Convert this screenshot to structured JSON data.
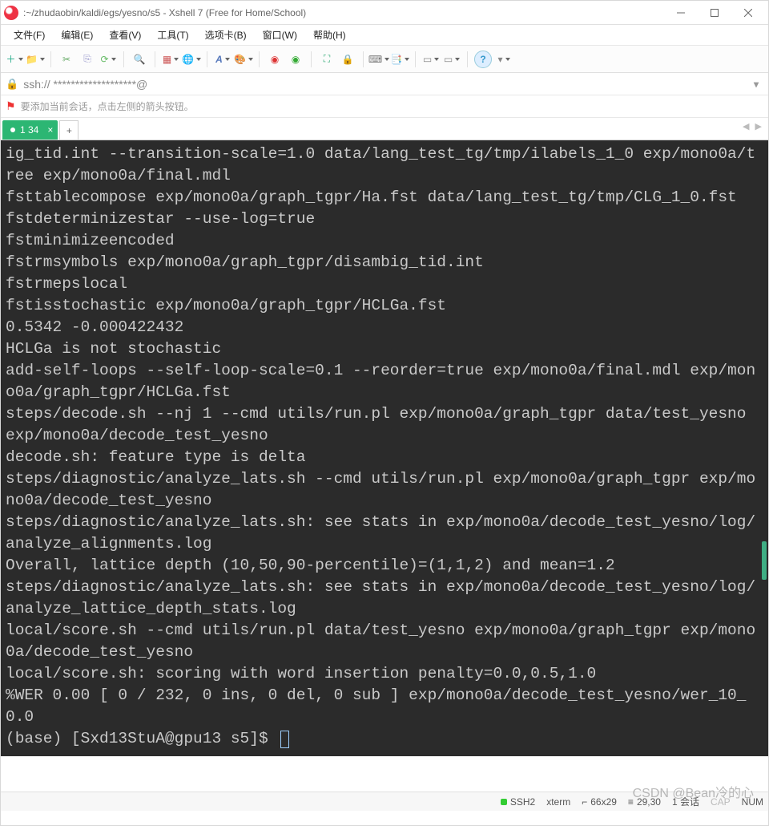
{
  "window": {
    "title_prefix": "",
    "title_path": ":~/zhudaobin/kaldi/egs/yesno/s5 - Xshell 7 (Free for Home/School)"
  },
  "menus": {
    "file": "文件(F)",
    "edit": "编辑(E)",
    "view": "查看(V)",
    "tools": "工具(T)",
    "tabs": "选项卡(B)",
    "window": "窗口(W)",
    "help": "帮助(H)"
  },
  "address": {
    "text": "ssh://                       *******************@"
  },
  "hint": {
    "text": "要添加当前会话，点击左侧的箭头按钮。"
  },
  "tabs": {
    "active": {
      "label": "1 34"
    }
  },
  "terminal": {
    "lines": [
      "ig_tid.int --transition-scale=1.0 data/lang_test_tg/tmp/ilabels_1_0 exp/mono0a/tree exp/mono0a/final.mdl",
      "fsttablecompose exp/mono0a/graph_tgpr/Ha.fst data/lang_test_tg/tmp/CLG_1_0.fst",
      "fstdeterminizestar --use-log=true",
      "fstminimizeencoded",
      "fstrmsymbols exp/mono0a/graph_tgpr/disambig_tid.int",
      "fstrmepslocal",
      "fstisstochastic exp/mono0a/graph_tgpr/HCLGa.fst",
      "0.5342 -0.000422432",
      "HCLGa is not stochastic",
      "add-self-loops --self-loop-scale=0.1 --reorder=true exp/mono0a/final.mdl exp/mono0a/graph_tgpr/HCLGa.fst",
      "steps/decode.sh --nj 1 --cmd utils/run.pl exp/mono0a/graph_tgpr data/test_yesno exp/mono0a/decode_test_yesno",
      "decode.sh: feature type is delta",
      "steps/diagnostic/analyze_lats.sh --cmd utils/run.pl exp/mono0a/graph_tgpr exp/mono0a/decode_test_yesno",
      "steps/diagnostic/analyze_lats.sh: see stats in exp/mono0a/decode_test_yesno/log/analyze_alignments.log",
      "Overall, lattice depth (10,50,90-percentile)=(1,1,2) and mean=1.2",
      "steps/diagnostic/analyze_lats.sh: see stats in exp/mono0a/decode_test_yesno/log/analyze_lattice_depth_stats.log",
      "local/score.sh --cmd utils/run.pl data/test_yesno exp/mono0a/graph_tgpr exp/mono0a/decode_test_yesno",
      "local/score.sh: scoring with word insertion penalty=0.0,0.5,1.0",
      "%WER 0.00 [ 0 / 232, 0 ins, 0 del, 0 sub ] exp/mono0a/decode_test_yesno/wer_10_0.0"
    ],
    "prompt": "(base) [Sxd13StuA@gpu13 s5]$"
  },
  "status": {
    "conn": "SSH2",
    "term": "xterm",
    "size": "66x29",
    "cursor": "29,30",
    "sessions": "1 会话",
    "caps": "CAP",
    "num": "NUM"
  },
  "watermark": "CSDN @Bean冷的心",
  "icons": {
    "new": "＋",
    "open": "📁",
    "link": "🔗",
    "copy": "📋",
    "paste": "📄",
    "refresh": "⟳",
    "search": "🔍",
    "layout": "▦",
    "globe": "🌐",
    "font": "A",
    "color": "🎨",
    "rec": "●",
    "play": "▶",
    "fullscreen": "⛶",
    "lock": "🔒",
    "keyboard": "⌨",
    "gear": "⚙",
    "w1": "▭",
    "w2": "▭",
    "help": "?"
  }
}
